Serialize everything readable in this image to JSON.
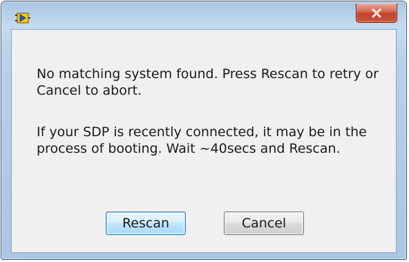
{
  "dialog": {
    "message_line1": "No matching system found. Press Rescan to retry or Cancel to abort.",
    "message_line2": "If your SDP is recently connected, it may be in the process of booting. Wait ~40secs and Rescan.",
    "rescan_label": "Rescan",
    "cancel_label": "Cancel",
    "app_icon": "labview-app-icon",
    "close_icon": "close-icon"
  },
  "colors": {
    "titlebar": "#b8d1ea",
    "close_button": "#c2402a",
    "client_background": "#f0f0f0",
    "default_button_border": "#3c7fb1"
  }
}
